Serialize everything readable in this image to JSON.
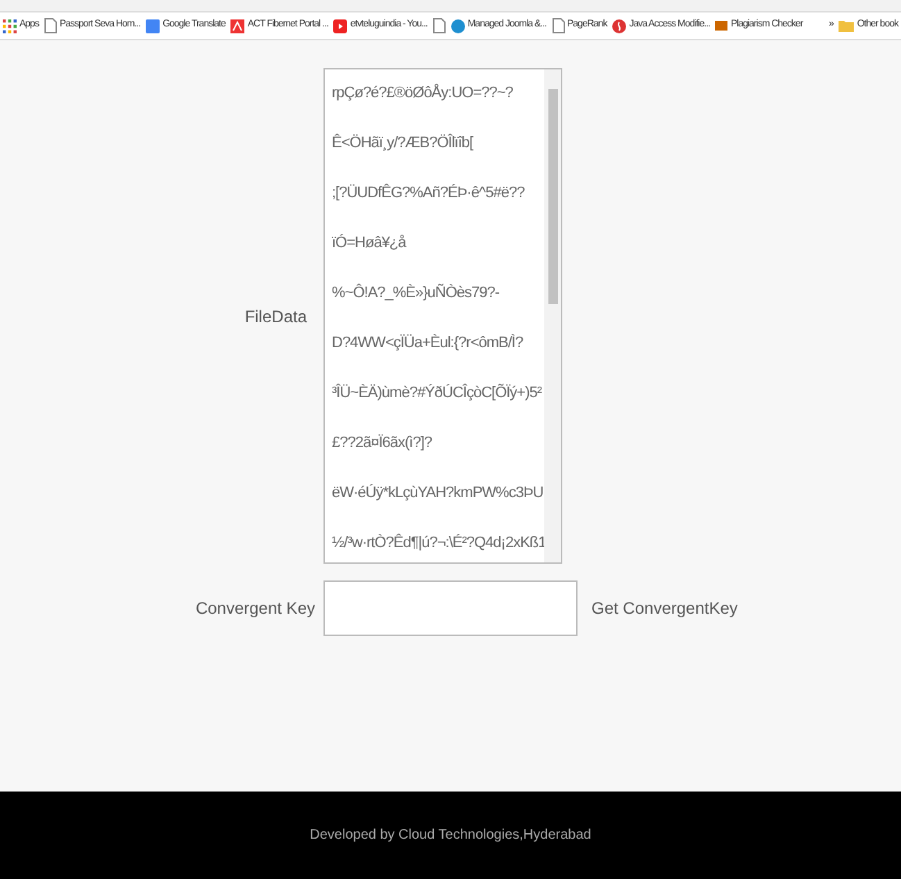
{
  "bookmarks_bar": {
    "items": [
      {
        "label": "Apps",
        "kind": "apps"
      },
      {
        "label": "Passport Seva Hom...",
        "kind": "page"
      },
      {
        "label": "Google Translate",
        "kind": "translate"
      },
      {
        "label": "ACT Fibernet Portal ...",
        "kind": "act"
      },
      {
        "label": "etvteluguindia - You...",
        "kind": "video"
      },
      {
        "kind": "page"
      },
      {
        "label": "Managed Joomla &...",
        "kind": "joomla"
      },
      {
        "label": "PageRank",
        "kind": "page"
      },
      {
        "label": "Java Access Modifie...",
        "kind": "java"
      },
      {
        "label": "Plagiarism Checker",
        "kind": "sst"
      }
    ],
    "overflow": "»",
    "other": "Other book"
  },
  "form": {
    "file_data": {
      "label": "FileData",
      "lines": [
        "rpÇø?é?£®öØôÅy:UO=??~?",
        "Ê<ÖHãï¸y/?ÆB?ÖÎlïîb[",
        ";[?ÜUDfÊG?%Añ?ÉÞ·ê^5#ë??",
        "ïÓ=Høâ¥¿å",
        "%~Ô!A?_%È»}uÑÒès79?-",
        "D?4WW<çÏÜa+Èul:{?r<ômB/Ì?",
        "³ÎÜ~ÈÄ)ùmè?#ÝðÚCÎçòC[ÕÏý+)5²",
        "£??2ã¤Ï6ãx(ì?]?",
        "ëW·éÚÿ*kLçùYAH?kmPW%c3ÞU",
        "½/³w·rtÒ?Êd¶|ú?¬:\\É²?Q4d¡2xKß1"
      ]
    },
    "convergent_key": {
      "label": "Convergent Key",
      "button": "Get ConvergentKey"
    }
  },
  "footer": {
    "text": "Developed by Cloud Technologies,Hyderabad"
  }
}
